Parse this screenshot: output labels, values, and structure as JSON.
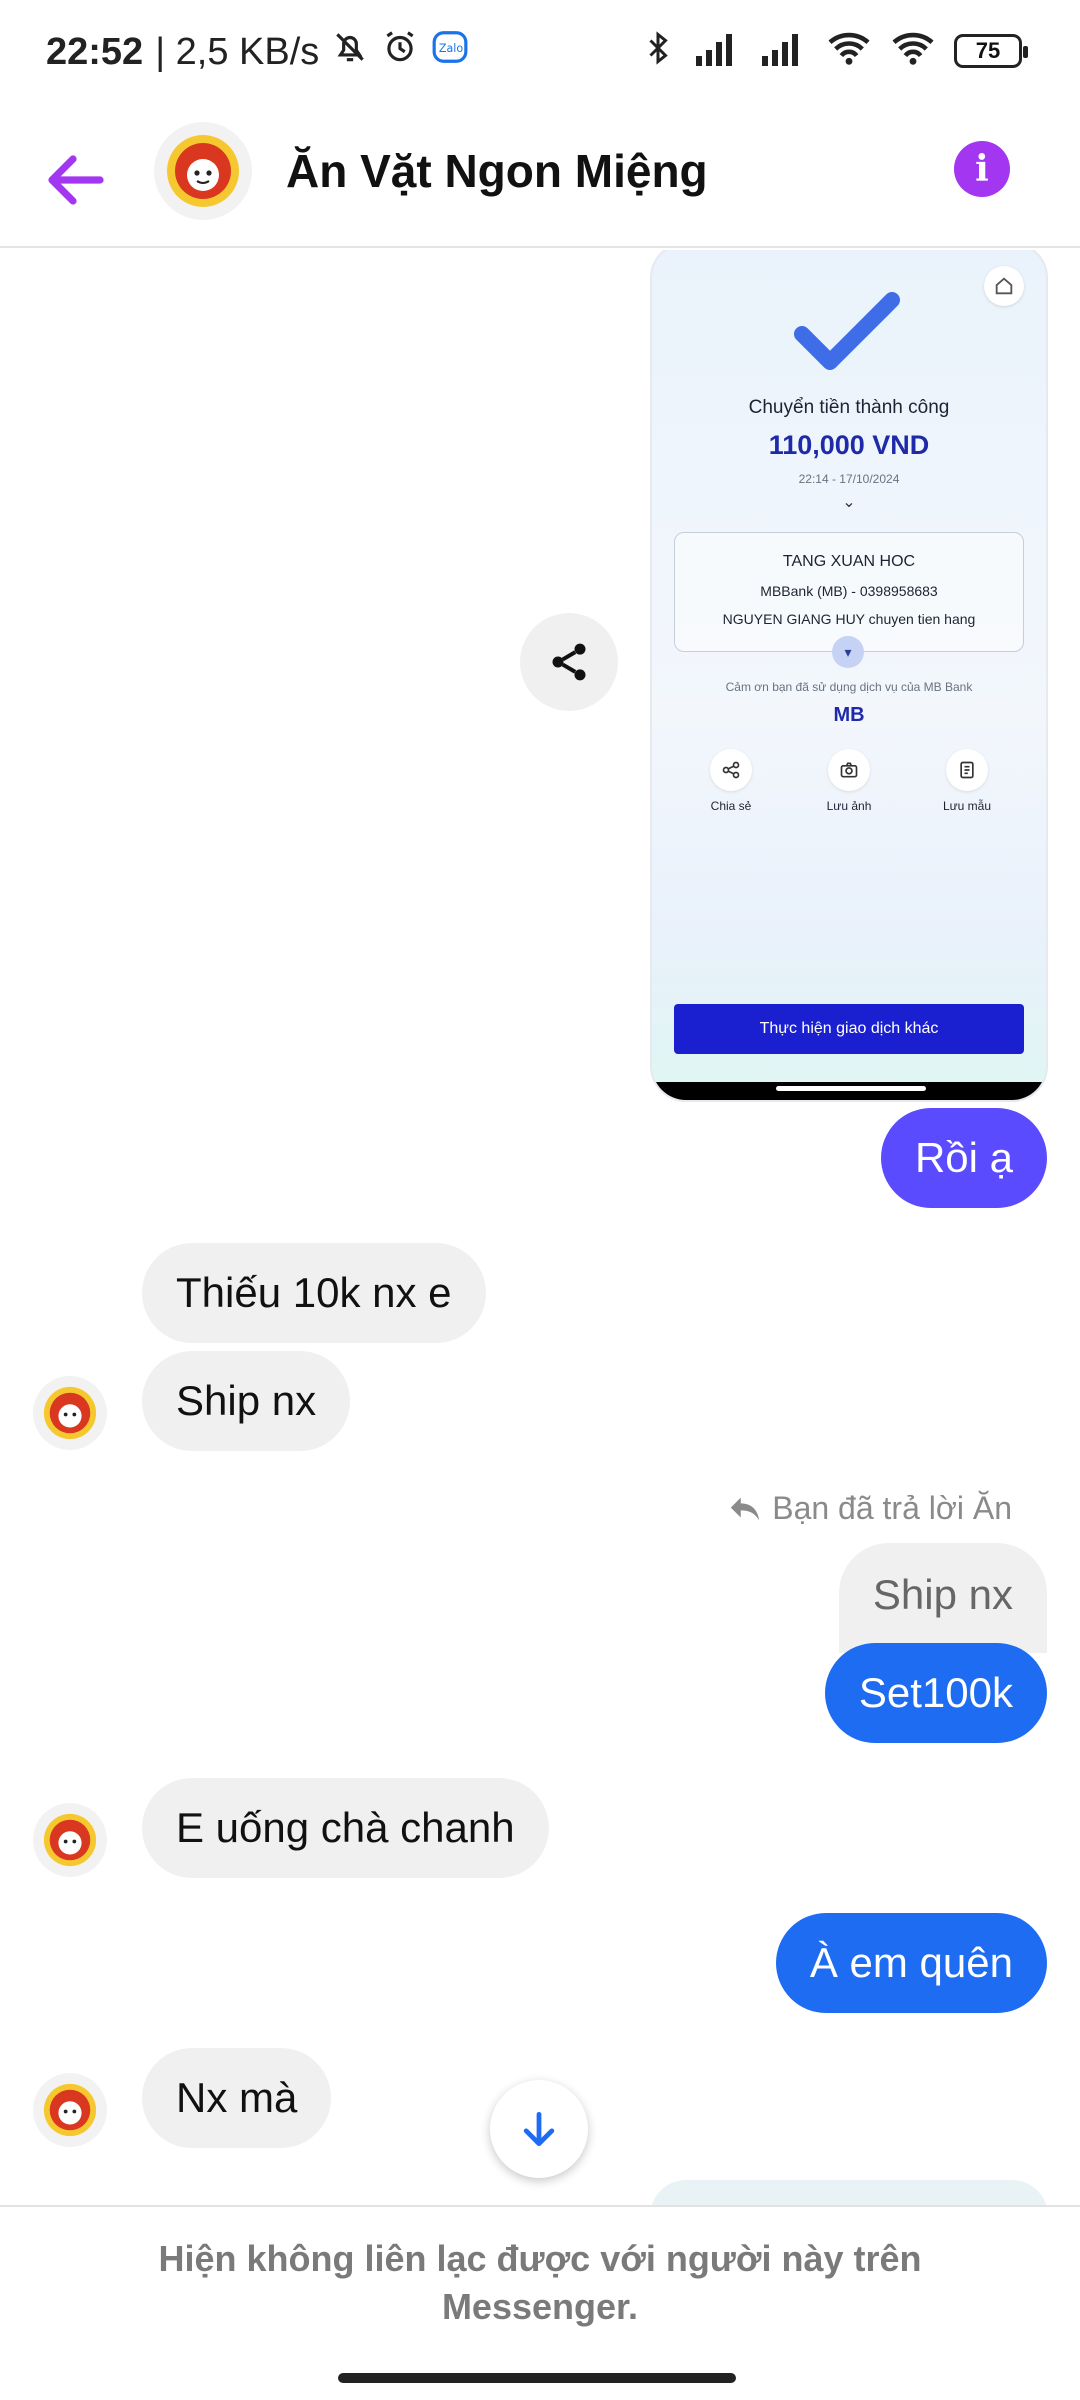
{
  "status_bar": {
    "time": "22:52",
    "network_speed": "| 2,5 KB/s",
    "battery": "75"
  },
  "header": {
    "contact_name": "Ăn Vặt Ngon Miệng",
    "info_glyph": "i"
  },
  "receipt": {
    "title": "Chuyển tiền thành công",
    "amount": "110,000 VND",
    "datetime": "22:14 - 17/10/2024",
    "recipient": "TANG XUAN HOC",
    "bank_account": "MBBank (MB) - 0398958683",
    "note": "NGUYEN GIANG HUY chuyen tien hang",
    "thanks": "Cảm ơn bạn đã sử dụng dịch vụ của MB Bank",
    "brand": "MB",
    "actions": [
      "Chia sẻ",
      "Lưu ảnh",
      "Lưu mẫu"
    ],
    "button": "Thực hiện giao dịch khác"
  },
  "messages": {
    "m1": "Rồi ạ",
    "m2": "Thiếu 10k nx e",
    "m3": "Ship nx",
    "reply_note": "Bạn đã trả lời Ăn",
    "quoted": "Ship nx",
    "m4": "Set100k",
    "m5": "E uống chà chanh",
    "m6": "À em quên",
    "m7": "Nx mà"
  },
  "footer": {
    "unavailable_text": "Hiện không liên lạc được với người này trên Messenger."
  },
  "colors": {
    "accent_purple": "#a336f0",
    "bubble_purple": "#5a4bff",
    "bubble_blue": "#1d6cf2",
    "bubble_grey": "#f0f0f0"
  }
}
